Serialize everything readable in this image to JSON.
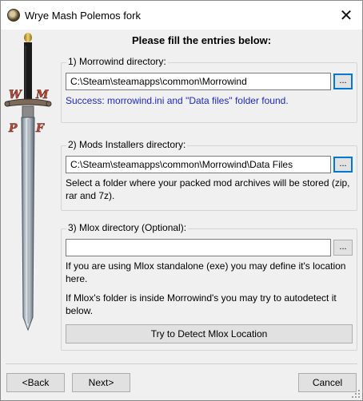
{
  "window": {
    "title": "Wrye Mash Polemos fork",
    "close_label": "✕"
  },
  "heading": "Please fill the entries below:",
  "sword_letters": [
    "W",
    "M",
    "P",
    "F"
  ],
  "sections": {
    "morrowind": {
      "label": "1) Morrowind directory:",
      "path": "C:\\Steam\\steamapps\\common\\Morrowind",
      "browse_label": "...",
      "status": "Success: morrowind.ini and \"Data files\" folder found."
    },
    "mods": {
      "label": "2) Mods Installers directory:",
      "path": "C:\\Steam\\steamapps\\common\\Morrowind\\Data Files",
      "browse_label": "...",
      "help": "Select a folder where your packed mod archives will be stored (zip, rar and 7z)."
    },
    "mlox": {
      "label": "3) Mlox directory (Optional):",
      "path": "",
      "browse_label": "...",
      "help1": "If you are using Mlox standalone (exe) you may define it's location here.",
      "help2": "If Mlox's folder is inside Morrowind's you may try to autodetect it below.",
      "detect_label": "Try to Detect Mlox Location"
    }
  },
  "footer": {
    "back": "<Back",
    "next": "Next>",
    "cancel": "Cancel"
  },
  "colors": {
    "success_text": "#1c28c8",
    "focus_border": "#0078d7"
  }
}
